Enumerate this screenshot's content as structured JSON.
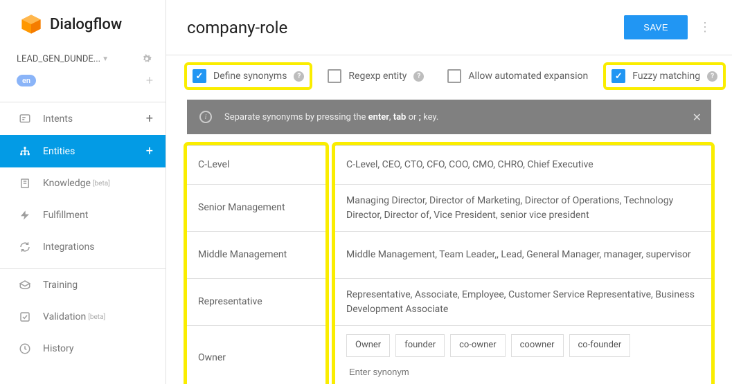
{
  "brand": "Dialogflow",
  "agent": {
    "name": "LEAD_GEN_DUNDE...",
    "lang": "en"
  },
  "nav": {
    "intents": "Intents",
    "entities": "Entities",
    "knowledge": "Knowledge",
    "knowledge_beta": "[beta]",
    "fulfillment": "Fulfillment",
    "integrations": "Integrations",
    "training": "Training",
    "validation": "Validation",
    "validation_beta": "[beta]",
    "history": "History"
  },
  "header": {
    "title": "company-role",
    "save": "SAVE"
  },
  "options": {
    "define_synonyms": {
      "label": "Define synonyms",
      "checked": true,
      "highlight": true
    },
    "regexp": {
      "label": "Regexp entity",
      "checked": false,
      "highlight": false
    },
    "auto_expand": {
      "label": "Allow automated expansion",
      "checked": false,
      "highlight": false
    },
    "fuzzy": {
      "label": "Fuzzy matching",
      "checked": true,
      "highlight": true
    }
  },
  "hint": {
    "pre": "Separate synonyms by pressing the ",
    "k1": "enter",
    "sep1": ", ",
    "k2": "tab",
    "sep2": " or ",
    "k3": ";",
    "post": " key."
  },
  "entities": [
    {
      "ref": "C-Level",
      "syn_display": "C-Level, CEO, CTO, CFO, COO, CMO, CHRO, Chief Executive",
      "height": "row-h"
    },
    {
      "ref": "Senior Management",
      "syn_display": "Managing Director, Director of Marketing, Director of Operations, Technology Director, Director of, Vice President, senior vice president",
      "height": "row-h2"
    },
    {
      "ref": "Middle Management",
      "syn_display": "Middle Management, Team Leader,, Lead, General Manager, manager, supervisor",
      "height": "row-h2"
    },
    {
      "ref": "Representative",
      "syn_display": "Representative, Associate, Employee, Customer Service Representative, Business Development Associate",
      "height": "row-h2"
    },
    {
      "ref": "Owner",
      "chips": [
        "Owner",
        "founder",
        "co-owner",
        "coowner",
        "co-founder"
      ],
      "placeholder": "Enter synonym",
      "height": "row-h3"
    }
  ],
  "colors": {
    "accent": "#2196f3",
    "highlight": "#faed00"
  }
}
